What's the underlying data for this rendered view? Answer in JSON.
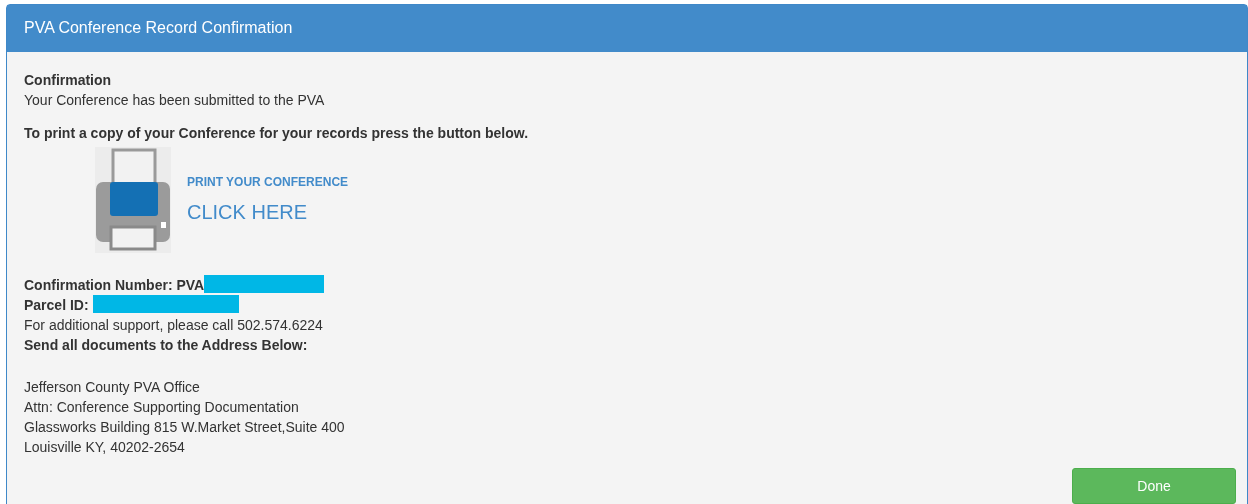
{
  "window": {
    "title": "PVA Conference Record Confirmation"
  },
  "confirmation": {
    "heading": "Confirmation",
    "message": "Your Conference has been submitted to the PVA"
  },
  "print_instructions": "To print a copy of your Conference for your records press the button below.",
  "print_link": {
    "caption": "PRINT YOUR CONFERENCE",
    "action": "CLICK HERE"
  },
  "details": [
    {
      "label": "Confirmation Number: PVA",
      "redacted": true
    },
    {
      "label": "Parcel ID:",
      "redacted": true
    }
  ],
  "support_text": "For additional support, please call 502.574.6224",
  "address_heading": "Send all documents to the Address Below:",
  "address_lines": [
    "Jefferson County PVA Office",
    "Attn: Conference Supporting Documentation",
    "Glassworks Building 815 W.Market Street,Suite 400",
    "Louisville KY, 40202-2654"
  ],
  "buttons": [
    {
      "label": "Done",
      "kind": "success"
    }
  ]
}
